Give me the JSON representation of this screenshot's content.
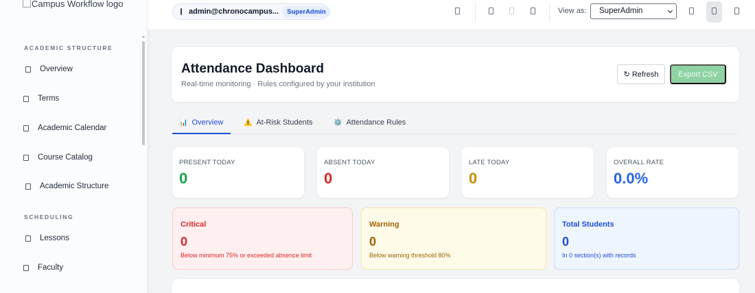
{
  "sidebar": {
    "logo_alt": "Campus Workflow logo",
    "sections": [
      {
        "title": "ACADEMIC STRUCTURE",
        "items": [
          {
            "label": "Overview"
          },
          {
            "label": "Terms"
          },
          {
            "label": "Academic Calendar"
          },
          {
            "label": "Course Catalog"
          },
          {
            "label": "Academic Structure"
          }
        ]
      },
      {
        "title": "SCHEDULING",
        "items": [
          {
            "label": "Lessons"
          },
          {
            "label": "Faculty"
          }
        ]
      }
    ]
  },
  "topbar": {
    "user_email": "admin@chronocampus...",
    "user_role": "SuperAdmin",
    "view_as_label": "View as:",
    "view_as_value": "SuperAdmin"
  },
  "header": {
    "title": "Attendance Dashboard",
    "subtitle": "Real-time monitoring · Rules configured by your institution",
    "refresh_label": "↻ Refresh",
    "export_label": "Export CSV"
  },
  "tabs": [
    {
      "glyph": "📊",
      "label": "Overview"
    },
    {
      "glyph": "⚠️",
      "label": "At-Risk Students"
    },
    {
      "glyph": "⚙️",
      "label": "Attendance Rules"
    }
  ],
  "stats": [
    {
      "label": "PRESENT TODAY",
      "value": "0",
      "color": "#16a34a"
    },
    {
      "label": "ABSENT TODAY",
      "value": "0",
      "color": "#dc2626"
    },
    {
      "label": "LATE TODAY",
      "value": "0",
      "color": "#ca8a04"
    },
    {
      "label": "OVERALL RATE",
      "value": "0.0%",
      "color": "#2563eb"
    }
  ],
  "risk": [
    {
      "title": "Critical",
      "value": "0",
      "desc": "Below minimum 75% or exceeded absence limit",
      "color": "#dc2626",
      "bg": "#fef0f0",
      "border": "#f8caca"
    },
    {
      "title": "Warning",
      "value": "0",
      "desc": "Below warning threshold 80%",
      "color": "#a16207",
      "bg": "#fefbe8",
      "border": "#f5e6a6"
    },
    {
      "title": "Total Students",
      "value": "0",
      "desc": "In 0 section(s) with records",
      "color": "#1d4ed8",
      "bg": "#eef5fd",
      "border": "#c9ddf6"
    }
  ]
}
